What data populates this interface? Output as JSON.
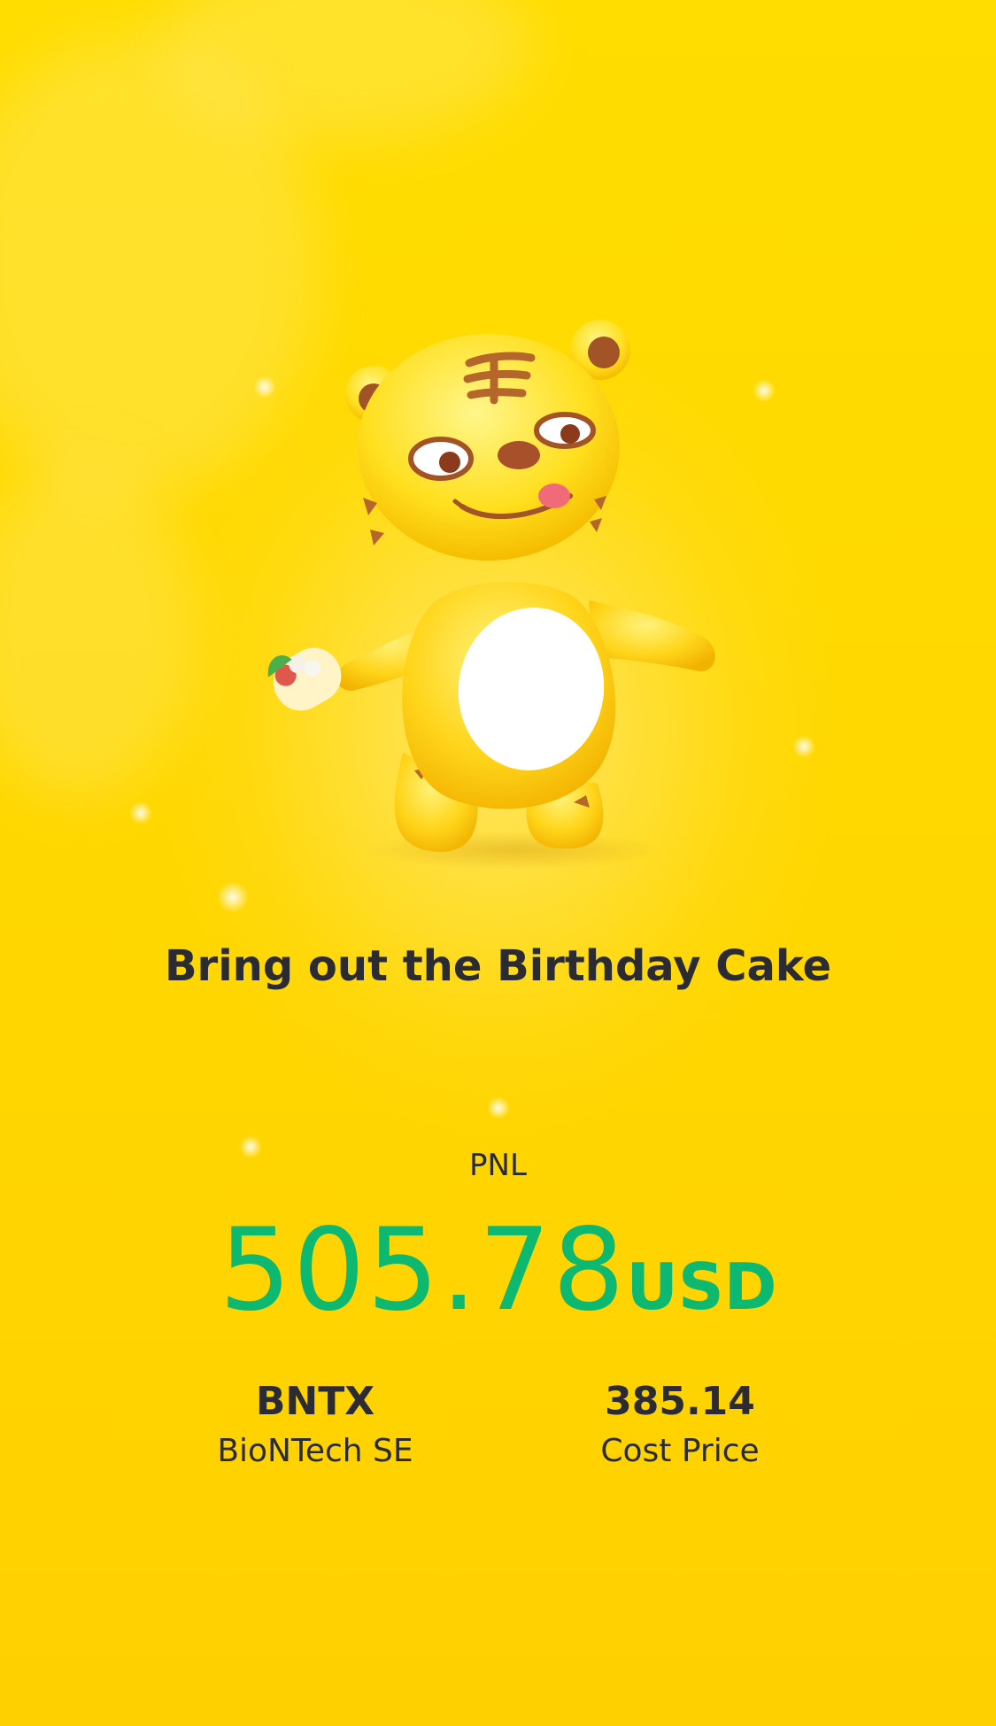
{
  "title": "Bring out the Birthday Cake",
  "pnl": {
    "label": "PNL",
    "value": "505.78",
    "unit": "USD"
  },
  "stock": {
    "symbol": "BNTX",
    "name": "BioNTech SE"
  },
  "cost": {
    "value": "385.14",
    "label": "Cost Price"
  },
  "colors": {
    "background": "#FFD600",
    "profit_green": "#0DB870",
    "text_dark": "#2b2b33"
  },
  "icons": {
    "mascot": "tiger-mascot-holding-burrito"
  }
}
